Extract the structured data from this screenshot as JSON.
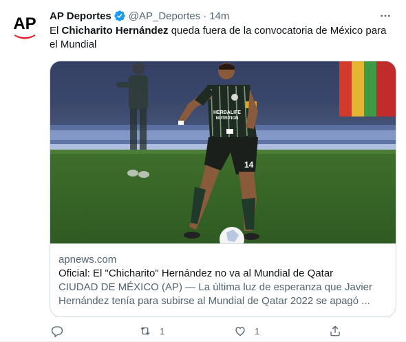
{
  "author": {
    "display_name": "AP Deportes",
    "handle": "@AP_Deportes",
    "separator": "·",
    "time": "14m",
    "avatar_text": "AP",
    "verified": true
  },
  "tweet": {
    "text_prefix": "El ",
    "text_bold": "Chicharito Hernández",
    "text_suffix": " queda fuera de la convocatoria de México para el Mundial"
  },
  "card": {
    "domain": "apnews.com",
    "title": "Oficial: El \"Chicharito\" Hernández no va al Mundial de Qatar",
    "description": "CIUDAD DE MÉXICO (AP) — La última luz de esperanza que Javier Hernández tenía para subirse al Mundial de Qatar 2022 se apagó ...",
    "jersey_sponsor": "HERBALIFE NUTRITION",
    "jersey_number": "14"
  },
  "actions": {
    "reply_count": "",
    "retweet_count": "1",
    "like_count": "1"
  },
  "colors": {
    "text_primary": "#0f1419",
    "text_secondary": "#536471",
    "verified_blue": "#1d9bf0",
    "ap_red": "#e4202e",
    "border": "#cfd9de"
  }
}
